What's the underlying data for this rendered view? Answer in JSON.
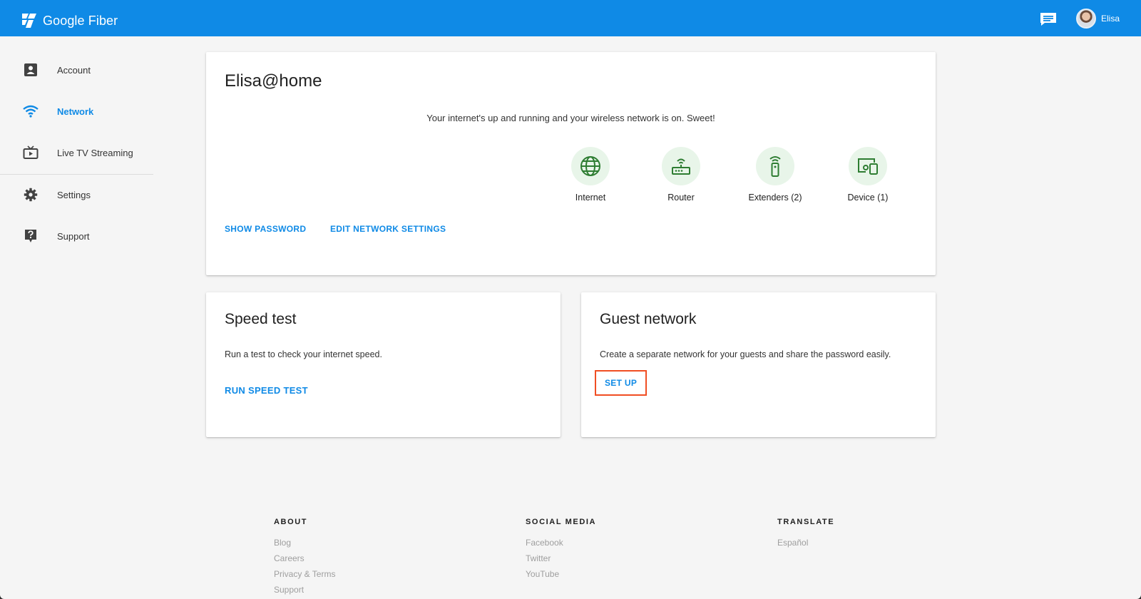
{
  "header": {
    "brand": "Google Fiber",
    "user_name": "Elisa",
    "colors": {
      "bar": "#0f8ae6",
      "accent": "#0f8ae6",
      "ok_green": "#2e7d32",
      "highlight": "#f04e23"
    }
  },
  "sidebar": {
    "items": [
      {
        "label": "Account",
        "icon": "account-box-icon",
        "active": false
      },
      {
        "label": "Network",
        "icon": "wifi-icon",
        "active": true
      },
      {
        "label": "Live TV Streaming",
        "icon": "tv-icon",
        "active": false
      },
      {
        "label": "Settings",
        "icon": "gear-icon",
        "active": false
      },
      {
        "label": "Support",
        "icon": "help-icon",
        "active": false
      }
    ]
  },
  "network_card": {
    "title": "Elisa@home",
    "status": "Your internet's up and running and your wireless network is on. Sweet!",
    "nodes": [
      {
        "label": "Internet",
        "icon": "globe-icon"
      },
      {
        "label": "Router",
        "icon": "router-icon"
      },
      {
        "label": "Extenders (2)",
        "icon": "extender-icon"
      },
      {
        "label": "Device (1)",
        "icon": "devices-icon"
      }
    ],
    "show_password": "SHOW PASSWORD",
    "edit_settings": "EDIT NETWORK SETTINGS"
  },
  "speed_card": {
    "title": "Speed test",
    "description": "Run a test to check your internet speed.",
    "action": "RUN SPEED TEST"
  },
  "guest_card": {
    "title": "Guest network",
    "description": "Create a separate network for your guests and share the password easily.",
    "action": "SET UP"
  },
  "footer": {
    "about": {
      "heading": "ABOUT",
      "links": [
        "Blog",
        "Careers",
        "Privacy & Terms",
        "Support"
      ]
    },
    "social": {
      "heading": "SOCIAL MEDIA",
      "links": [
        "Facebook",
        "Twitter",
        "YouTube"
      ]
    },
    "translate": {
      "heading": "TRANSLATE",
      "links": [
        "Español"
      ]
    }
  }
}
